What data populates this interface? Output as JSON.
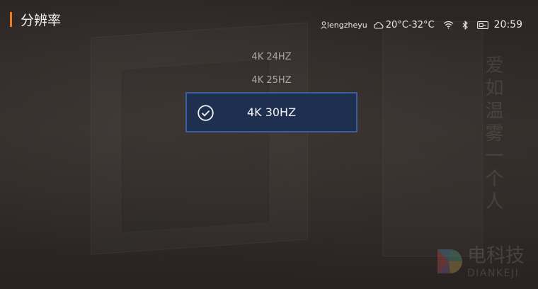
{
  "header": {
    "title": "分辨率"
  },
  "status_bar": {
    "user": "lengzheyu",
    "weather": "20°C-32°C",
    "time": "20:59",
    "icons": [
      "user-icon",
      "cloud-icon",
      "wifi-icon",
      "bluetooth-icon",
      "video-input-icon"
    ]
  },
  "menu": {
    "options": [
      {
        "label": "4K 24HZ",
        "selected": false
      },
      {
        "label": "4K 25HZ",
        "selected": false
      },
      {
        "label": "4K 30HZ",
        "selected": true
      }
    ]
  },
  "background": {
    "text": "爱如温雾一个人"
  },
  "watermark": {
    "cn": "电科技",
    "en": "DIANKEJI"
  },
  "colors": {
    "accent": "#f07a24",
    "selected_bg": "#1f2f4f",
    "selected_border": "#3a5f9c"
  }
}
